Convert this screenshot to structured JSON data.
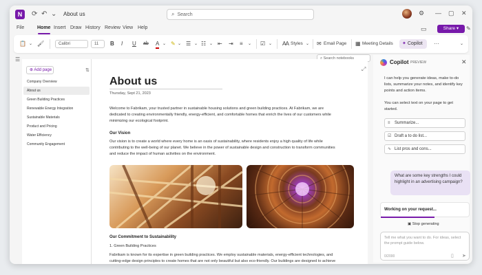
{
  "window": {
    "title": "About us",
    "search_placeholder": "Search",
    "share_label": "Share ▾"
  },
  "menu": [
    "File",
    "Home",
    "Insert",
    "Draw",
    "History",
    "Review",
    "View",
    "Help"
  ],
  "ribbon": {
    "font_name": "Calibri",
    "font_size": "11",
    "styles_label": "Styles",
    "email_page_label": "Email Page",
    "meeting_details_label": "Meeting Details",
    "copilot_label": "Copilot",
    "more_label": "···"
  },
  "search_notebooks": "Search notebooks",
  "pages": {
    "add_page_label": "Add page",
    "items": [
      "Company Overview",
      "About us",
      "Green Building Practices",
      "Renewable Energy Integration",
      "Sustainable Materials",
      "Product and Pricing",
      "Water Efficiency",
      "Community Engagement"
    ],
    "selected_index": 1
  },
  "page": {
    "title": "About us",
    "date": "Thursday, Sept 21, 2023",
    "intro": "Welcome to Fabrikam, your trusted partner in sustainable housing solutions and green building practices. At Fabrikam, we are dedicated to creating environmentally friendly, energy-efficient, and comfortable homes that enrich the lives of our customers while minimizing our ecological footprint.",
    "vision_heading": "Our Vision",
    "vision_text": "Our vision is to create a world where every home is an oasis of sustainability, where residents enjoy a high quality of life while contributing to the well-being of our planet. We believe in the power of sustainable design and construction to transform communities and reduce the impact of human activities on the environment.",
    "commitment_heading": "Our Commitment to Sustainability",
    "commitment_item": "1. Green Building Practices",
    "commitment_text": "Fabrikam is known for its expertise in green building practices. We employ sustainable materials, energy-efficient technologies, and cutting-edge design principles to create homes that are not only beautiful but also eco-friendly. Our buildings are designed to achieve high levels of energy efficiency, reducing utility costs and carbon emissions."
  },
  "copilot": {
    "title": "Copilot",
    "badge": "PREVIEW",
    "intro": "I can help you generate ideas, make to-do lists, summarize your notes, and identify key points and action items.",
    "hint": "You can select text on your page to get started.",
    "chips": [
      {
        "icon": "≡",
        "label": "Summarize..."
      },
      {
        "icon": "☑",
        "label": "Draft a to do list..."
      },
      {
        "icon": "∿",
        "label": "List pros and cons..."
      }
    ],
    "user_message": "What are some key strengths I could highlight in an advertising campaign?",
    "working_label": "Working on your request...",
    "working_progress": 0.6,
    "stop_label": "Stop generating",
    "input_placeholder": "Tell me what you want to do. For ideas, select the prompt guide below.",
    "counter": "0/2000"
  }
}
